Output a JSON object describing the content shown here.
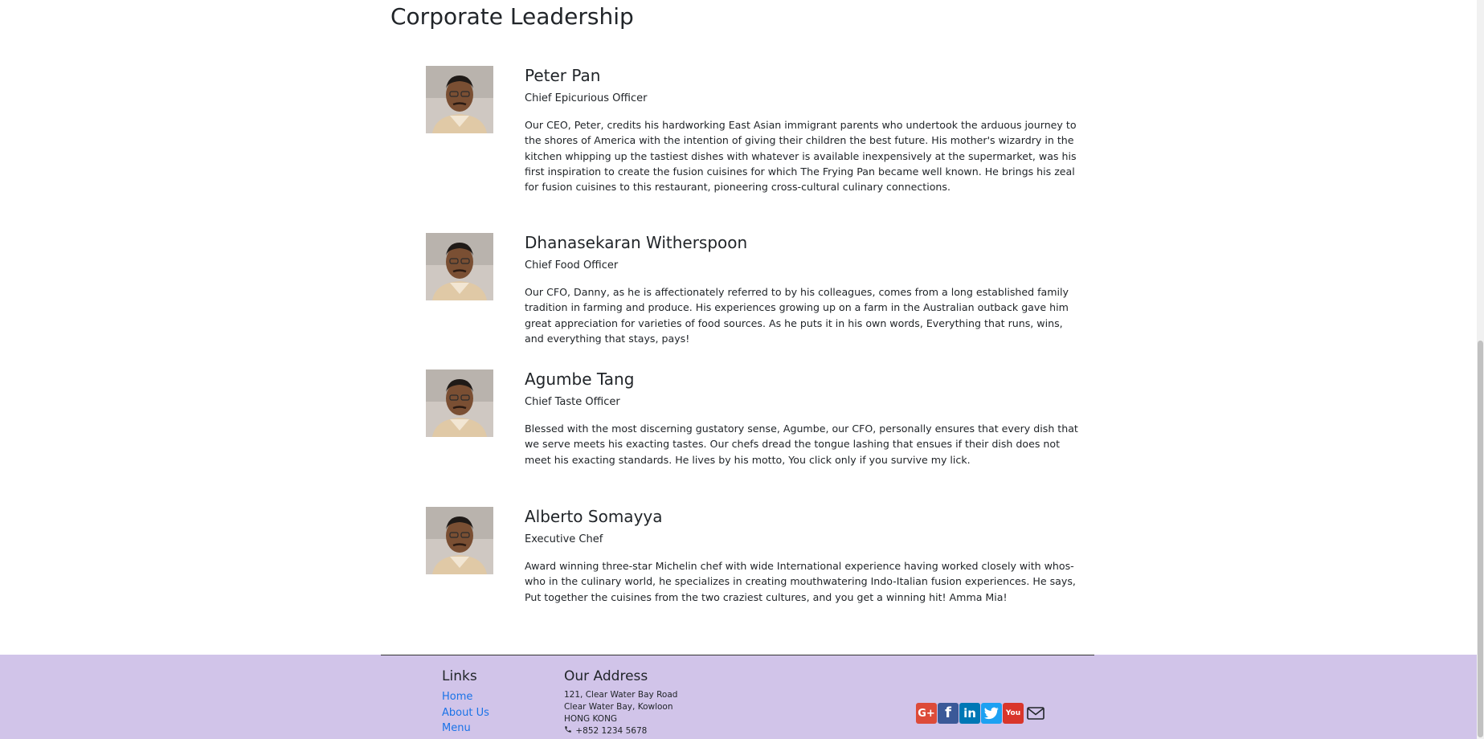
{
  "page": {
    "section_title": "Corporate Leadership"
  },
  "leaders": [
    {
      "name": "Peter Pan",
      "role": "Chief Epicurious Officer",
      "bio": "Our CEO, Peter, credits his hardworking East Asian immigrant parents who undertook the arduous journey to the shores of America with the intention of giving their children the best future. His mother's wizardry in the kitchen whipping up the tastiest dishes with whatever is available inexpensively at the supermarket, was his first inspiration to create the fusion cuisines for which The Frying Pan became well known. He brings his zeal for fusion cuisines to this restaurant, pioneering cross-cultural culinary connections."
    },
    {
      "name": "Dhanasekaran Witherspoon",
      "role": "Chief Food Officer",
      "bio": "Our CFO, Danny, as he is affectionately referred to by his colleagues, comes from a long established family tradition in farming and produce. His experiences growing up on a farm in the Australian outback gave him great appreciation for varieties of food sources. As he puts it in his own words, Everything that runs, wins, and everything that stays, pays!"
    },
    {
      "name": "Agumbe Tang",
      "role": "Chief Taste Officer",
      "bio": "Blessed with the most discerning gustatory sense, Agumbe, our CFO, personally ensures that every dish that we serve meets his exacting tastes. Our chefs dread the tongue lashing that ensues if their dish does not meet his exacting standards. He lives by his motto, You click only if you survive my lick."
    },
    {
      "name": "Alberto Somayya",
      "role": "Executive Chef",
      "bio": "Award winning three-star Michelin chef with wide International experience having worked closely with whos-who in the culinary world, he specializes in creating mouthwatering Indo-Italian fusion experiences. He says, Put together the cuisines from the two craziest cultures, and you get a winning hit! Amma Mia!"
    }
  ],
  "footer": {
    "links_heading": "Links",
    "links": [
      "Home",
      "About Us",
      "Menu"
    ],
    "address_heading": "Our Address",
    "address_line1": "121, Clear Water Bay Road",
    "address_line2": "Clear Water Bay, Kowloon",
    "address_line3": "HONG KONG",
    "phone": "+852 1234 5678",
    "social": [
      {
        "icon": "google-plus-icon",
        "color": "#dd4b39",
        "glyph": "G+"
      },
      {
        "icon": "facebook-icon",
        "color": "#3b5998",
        "glyph": "f"
      },
      {
        "icon": "linkedin-icon",
        "color": "#0077b5",
        "glyph": "in"
      },
      {
        "icon": "twitter-icon",
        "color": "#1da1f2",
        "glyph": ""
      },
      {
        "icon": "youtube-icon",
        "color": "#d9362b",
        "glyph": "You"
      },
      {
        "icon": "mail-icon",
        "color": "#212529",
        "glyph": ""
      }
    ]
  },
  "colors": {
    "footer_bg": "#d1c4e9",
    "link": "#1a73e8"
  }
}
